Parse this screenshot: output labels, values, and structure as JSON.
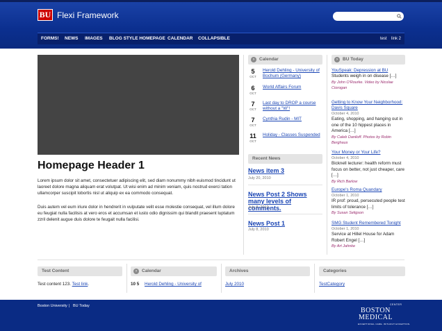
{
  "header": {
    "logo_text": "BU",
    "site_title": "Flexi Framework",
    "search_placeholder": ""
  },
  "nav": {
    "items": [
      "FORMS!",
      "NEWS",
      "IMAGES",
      "BLOG STYLE HOMEPAGE",
      "CALENDAR",
      "COLLAPSIBLE"
    ],
    "right_items": [
      "test",
      "link 2"
    ]
  },
  "main": {
    "title": "Homepage Header 1",
    "paragraphs": [
      "Lorem ipsum dolor sit amet, consectetuer adipiscing elit, sed diam nonummy nibh euismod tincidunt ut laoreet dolore magna aliquam erat volutpat. Ut wisi enim ad minim veniam, quis nostrud exerci tation ullamcorper suscipit lobortis nisl ut aliquip ex ea commodo consequat.",
      "Duis autem vel eum iriure dolor in hendrerit in vulputate velit esse molestie consequat, vel illum dolore eu feugiat nulla facilisis at vero eros et accumsan et iusto odio dignissim qui blandit praesent luptatum zzril delenit augue duis dolore te feugait nulla facilisi."
    ]
  },
  "calendar": {
    "header": "Calendar",
    "events": [
      {
        "day": "5",
        "month": "OCT",
        "title": "Herold Dehling - University of Bochum (Germany)"
      },
      {
        "day": "6",
        "month": "OCT",
        "title": "World Affairs Forum"
      },
      {
        "day": "7",
        "month": "OCT",
        "title": "Last day to DROP a course without a \"W\"!"
      },
      {
        "day": "7",
        "month": "OCT",
        "title": "Cynthia Rudin - MIT"
      },
      {
        "day": "11",
        "month": "OCT",
        "title": "Holiday - Classes Suspended"
      }
    ]
  },
  "recent_news": {
    "header": "Recent News",
    "items": [
      {
        "title": "News item 3",
        "date": "July 20, 2010"
      },
      {
        "title": "News Post 2 Shows many levels of comments.",
        "date": "July 8, 2010"
      },
      {
        "title": "News Post 1",
        "date": "July 8, 2010"
      }
    ]
  },
  "bu_today": {
    "header": "BU Today",
    "items": [
      {
        "title": "YouSpeak: Depression at BU",
        "date": "",
        "text": "Students weigh in on disease […]",
        "author": "By John O'Rourke. Video by Nicolae Ciorogan"
      },
      {
        "title": "Getting to Know Your Neighborhood: Davis Square",
        "date": "October 4, 2010",
        "text": "Eating, shopping, and hanging out in one of the 10 hippest places in America […]",
        "author": "By Caleb Daniloff. Photos by Robin Berghaus"
      },
      {
        "title": "Your Money or Your Life?",
        "date": "October 4, 2010",
        "text": "Bicknell lecturer: health reform must focus on better, not just cheaper, care […]",
        "author": "By Rich Barlow"
      },
      {
        "title": "Europe's Roma Quandary",
        "date": "October 1, 2010",
        "text": "IR prof: proud, persecuted people test limits of tolerance […]",
        "author": "By Susan Seligson"
      },
      {
        "title": "SMG Student Remembered Tonight",
        "date": "October 1, 2010",
        "text": "Service at Hillel House for Adam Robert Engel […]",
        "author": "By Art Jahnke"
      }
    ]
  },
  "bottom": {
    "test_content": {
      "header": "Test Content",
      "text": "Test content 123.",
      "link": "Test link",
      "after": "."
    },
    "calendar": {
      "header": "Calendar",
      "date": "10 5",
      "title": "Herold Dehling - University of"
    },
    "archives": {
      "header": "Archives",
      "link": "July 2010"
    },
    "categories": {
      "header": "Categories",
      "link": "TestCategory"
    }
  },
  "footer": {
    "links": [
      "Boston University",
      "BU Today"
    ],
    "separator": "|",
    "logo_line1": "BOSTON",
    "logo_line2": "MEDICAL",
    "logo_center": "CENTER",
    "logo_tagline": "EXCEPTIONAL CARE. WITHOUT EXCEPTION."
  },
  "colors": {
    "header_blue": "#0b2f8f",
    "nav_dark": "#08206b",
    "link_blue": "#1a45b4",
    "author_magenta": "#9a2a6d",
    "logo_red": "#cc0000"
  },
  "icons": {
    "search": "search-icon",
    "calendar_bullet": "arrow-bullet-icon"
  }
}
